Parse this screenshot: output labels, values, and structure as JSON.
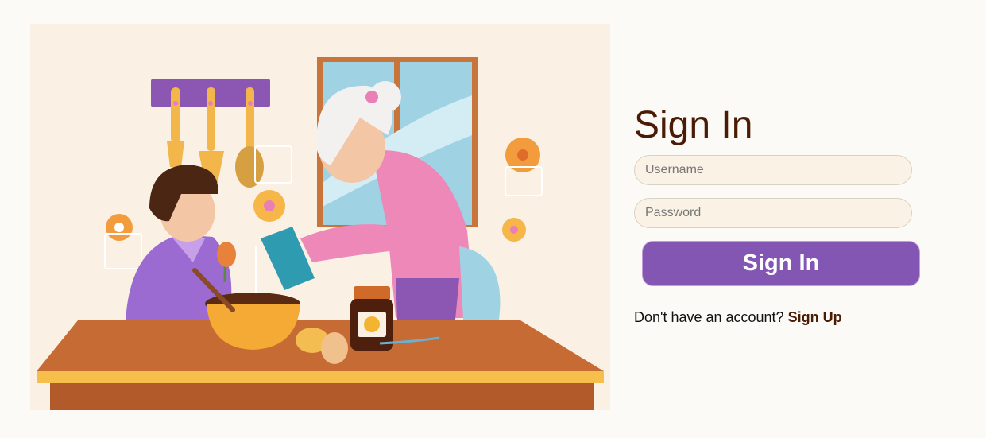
{
  "signin": {
    "title": "Sign In",
    "username_placeholder": "Username",
    "password_placeholder": "Password",
    "submit_label": "Sign In",
    "signup_prompt": "Don't have an account?",
    "signup_link": "Sign Up"
  },
  "colors": {
    "background": "#fcfaf7",
    "title": "#4a1c06",
    "button": "#8356b4",
    "input_fill": "#faf2e5"
  }
}
